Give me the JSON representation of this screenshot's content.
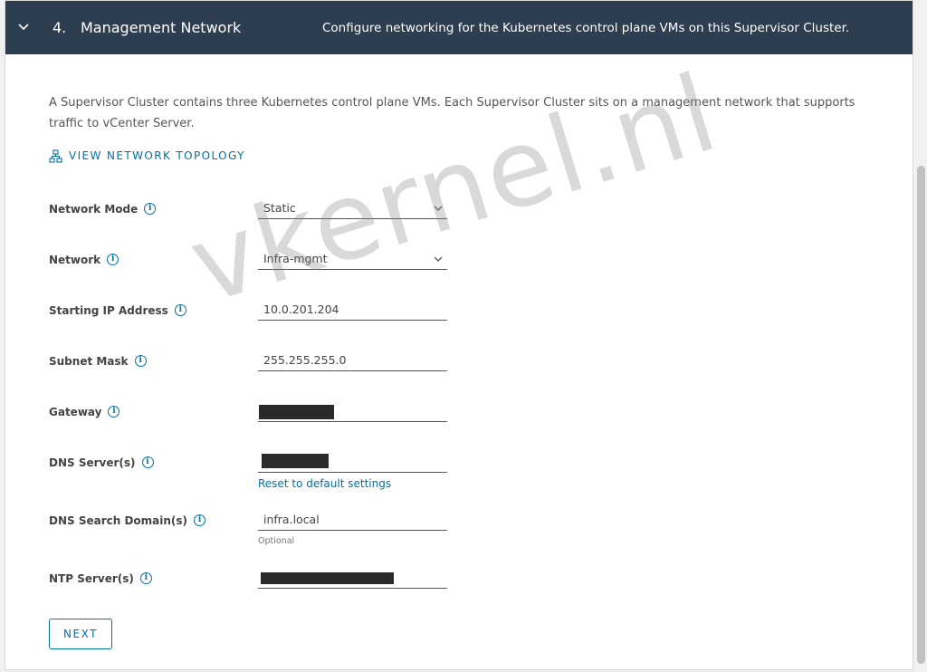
{
  "header": {
    "step": "4.",
    "title": "Management Network",
    "description": "Configure networking for the Kubernetes control plane VMs on this Supervisor Cluster."
  },
  "intro": "A Supervisor Cluster contains three Kubernetes control plane VMs. Each Supervisor Cluster sits on a management network that supports traffic to vCenter Server.",
  "topology_link": "VIEW NETWORK TOPOLOGY",
  "fields": {
    "network_mode": {
      "label": "Network Mode",
      "value": "Static"
    },
    "network": {
      "label": "Network",
      "value": "Infra-mgmt"
    },
    "starting_ip": {
      "label": "Starting IP Address",
      "value": "10.0.201.204"
    },
    "subnet_mask": {
      "label": "Subnet Mask",
      "value": "255.255.255.0"
    },
    "gateway": {
      "label": "Gateway"
    },
    "dns_servers": {
      "label": "DNS Server(s)",
      "reset_link": "Reset to default settings"
    },
    "dns_search": {
      "label": "DNS Search Domain(s)",
      "value": "infra.local",
      "helper": "Optional"
    },
    "ntp_servers": {
      "label": "NTP Server(s)"
    }
  },
  "next_button": "NEXT",
  "watermark": "vkernel.nl",
  "colors": {
    "header_bg": "#2c3e4f",
    "link": "#0072a3"
  }
}
